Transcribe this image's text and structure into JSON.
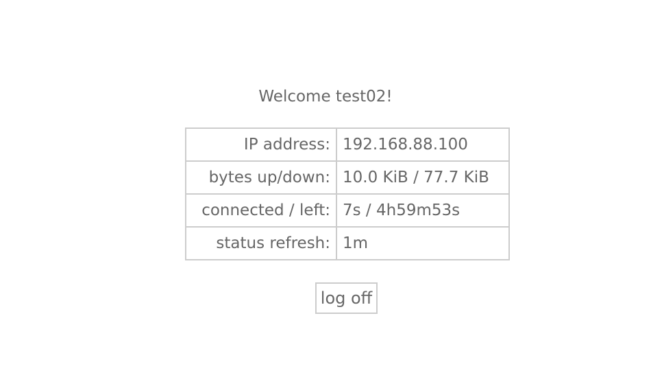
{
  "welcome": "Welcome test02!",
  "status_table": {
    "rows": [
      {
        "label": "IP address:",
        "value": "192.168.88.100"
      },
      {
        "label": "bytes up/down:",
        "value": "10.0 KiB / 77.7 KiB"
      },
      {
        "label": "connected / left:",
        "value": "7s / 4h59m53s"
      },
      {
        "label": "status refresh:",
        "value": "1m"
      }
    ]
  },
  "logoff_button": {
    "label": "log off"
  }
}
